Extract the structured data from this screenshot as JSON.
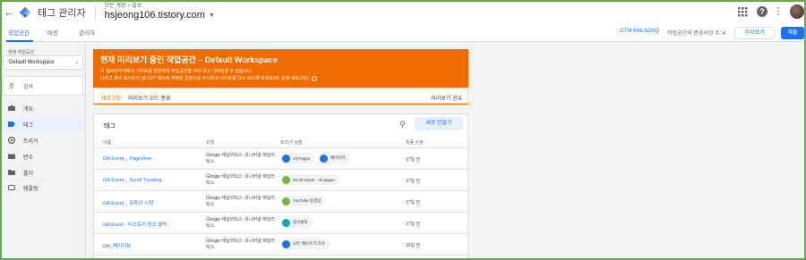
{
  "header": {
    "app_name": "태그 관리자",
    "breadcrumb": "모든 계정 > 블로",
    "container_name": "hsjeong106.tistory.com"
  },
  "tabs": [
    "작업공간",
    "버전",
    "관리자"
  ],
  "workspace_bar": {
    "container_id": "GTM-NNLN2NQ",
    "changes": "작업공간의 변경사항 수: 4",
    "preview_button": "미리보기",
    "submit_button": "제출"
  },
  "sidebar": {
    "workspace_label": "현재 작업공간",
    "workspace_name": "Default Workspace",
    "search_placeholder": "검색",
    "items": [
      {
        "label": "개요",
        "icon": "briefcase-icon"
      },
      {
        "label": "태그",
        "icon": "tag-icon"
      },
      {
        "label": "트리거",
        "icon": "trigger-icon"
      },
      {
        "label": "변수",
        "icon": "variable-icon"
      },
      {
        "label": "폴더",
        "icon": "folder-icon"
      },
      {
        "label": "템플릿",
        "icon": "template-icon"
      }
    ],
    "active_index": 1
  },
  "preview_banner": {
    "title": "현재 미리보기 중인 작업공간 – Default Workspace",
    "line1": "이 웹브라우저에서 사이트를 방문하여 작업공간을 미리 보고 디버깅할 수 있습니다.",
    "line2": "디버그 창이 표시되지 않나요? 캐시에 저장된 콘텐츠를 무시하고 사이트를 다시 로드해 보세요(예: 강제 새로고침).",
    "refresh": "새로고침",
    "exit_preview": "미리보기 모드 종료",
    "share_preview": "미리보기 공유",
    "color": "#ef6c00"
  },
  "tags_card": {
    "title": "태그",
    "new_button": "새로 만들기",
    "columns": [
      "이름 ↑",
      "유형",
      "트리거 실행",
      "최종 수정"
    ],
    "rows": [
      {
        "name": "GA Event _ PageView",
        "type": "Google 애널리틱스: 유니버설 애널리틱스",
        "triggers": [
          {
            "label": "All Pages",
            "color": "#1a73e8"
          },
          {
            "label": "페이지뷰",
            "color": "#1a73e8"
          }
        ],
        "modified": "17일 전"
      },
      {
        "name": "GA Event _ Scroll Tracking",
        "type": "Google 애널리틱스: 유니버설 애널리틱스",
        "triggers": [
          {
            "label": "Scroll Depth - All pages",
            "color": "#7cb342"
          }
        ],
        "modified": "17일 전"
      },
      {
        "name": "GA Event _ 유튜브 시청",
        "type": "Google 애널리틱스: 유니버설 애널리틱스",
        "triggers": [
          {
            "label": "YouTube 동영상",
            "color": "#7cb342"
          }
        ],
        "modified": "17일 전"
      },
      {
        "name": "GA Evevt - 티스토리 링크 클릭",
        "type": "Google 애널리틱스: 유니버설 애널리틱스",
        "triggers": [
          {
            "label": "링크클릭",
            "color": "#00acc1"
          }
        ],
        "modified": "17일 전"
      },
      {
        "name": "GA_페이지뷰",
        "type": "Google 애널리틱스: 유니버설 애널리틱스",
        "triggers": [
          {
            "label": "모든 페이지 트리거",
            "color": "#1a73e8"
          }
        ],
        "modified": "16일 전"
      }
    ]
  }
}
